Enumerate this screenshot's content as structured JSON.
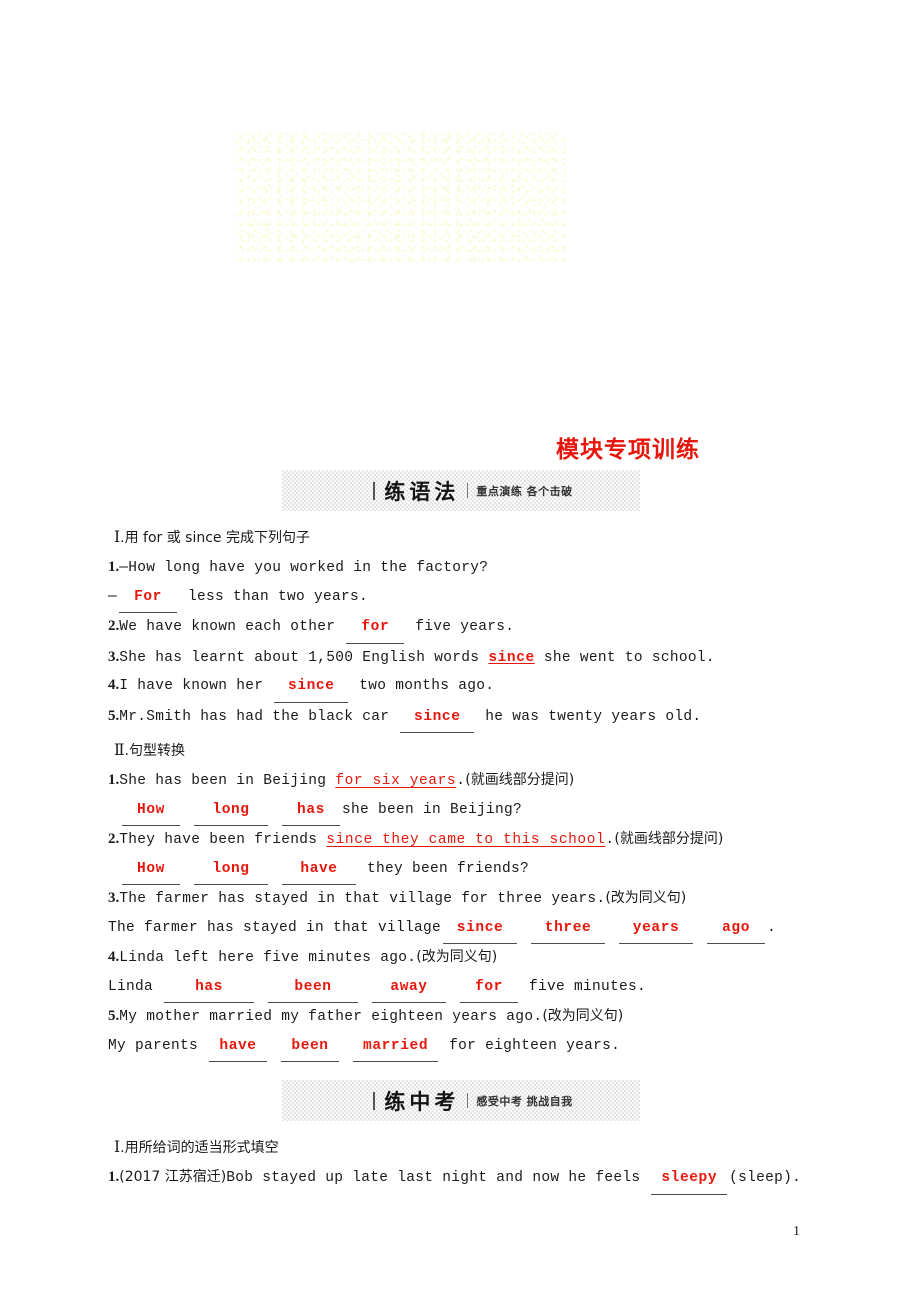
{
  "document": {
    "title": "模块专项训练",
    "page_number": "1",
    "watermark": "faint-dotted-graphic"
  },
  "sections": [
    {
      "banner": {
        "main": "练语法",
        "sub": "重点演练 各个击破"
      },
      "groups": [
        {
          "heading_roman": "Ⅰ",
          "heading_text": ".用 for 或 since 完成下列句子",
          "items": [
            {
              "number": "1.",
              "lines": [
                {
                  "text": "—How long have you worked in the factory?"
                },
                {
                  "prefix": "—",
                  "answer": "For",
                  "suffix": " less than two years."
                }
              ]
            },
            {
              "number": "2.",
              "lines": [
                {
                  "prefix": "We have known each other ",
                  "answer": "for",
                  "suffix": " five years."
                }
              ]
            },
            {
              "number": "3.",
              "lines": [
                {
                  "prefix": "She has learnt about 1,500 English words ",
                  "answer_inline": "since",
                  "suffix": " she went to school."
                }
              ]
            },
            {
              "number": "4.",
              "lines": [
                {
                  "prefix": "I have known her ",
                  "answer": "since",
                  "suffix": " two months ago."
                }
              ]
            },
            {
              "number": "5.",
              "lines": [
                {
                  "prefix": "Mr.Smith has had the black car ",
                  "answer": "since",
                  "suffix": " he was twenty years old."
                }
              ]
            }
          ]
        },
        {
          "heading_roman": "Ⅱ",
          "heading_text": ".句型转换",
          "items": [
            {
              "number": "1.",
              "prompt_prefix": "She has been in Beijing ",
              "prompt_underline": "for six years",
              "prompt_suffix": ".",
              "prompt_note": "(就画线部分提问)",
              "answers": [
                "How",
                "long",
                "has"
              ],
              "answer_tail": "she been in Beijing?"
            },
            {
              "number": "2.",
              "prompt_prefix": "They have been friends ",
              "prompt_underline": "since they came to this school",
              "prompt_suffix": ".",
              "prompt_note": "(就画线部分提问)",
              "answers": [
                "How",
                "long",
                "have"
              ],
              "answer_tail": " they been friends?"
            },
            {
              "number": "3.",
              "prompt_prefix": "The farmer has stayed in that village for three years.",
              "prompt_note": "(改为同义句)",
              "answer_lead": "The farmer has stayed in that village",
              "answers": [
                "since",
                "three",
                "years",
                "ago"
              ],
              "answer_tail": "."
            },
            {
              "number": "4.",
              "prompt_prefix": "Linda left here five minutes ago.",
              "prompt_note": "(改为同义句)",
              "answer_lead": "Linda ",
              "answers": [
                "has",
                "been",
                "away",
                "for"
              ],
              "answer_tail": " five minutes."
            },
            {
              "number": "5.",
              "prompt_prefix": "My mother married my father eighteen years ago.",
              "prompt_note": "(改为同义句)",
              "answer_lead": "My parents ",
              "answers": [
                "have",
                "been",
                "married"
              ],
              "answer_tail": " for eighteen years."
            }
          ]
        }
      ]
    },
    {
      "banner": {
        "main": "练中考",
        "sub": "感受中考 挑战自我"
      },
      "groups": [
        {
          "heading_roman": "Ⅰ",
          "heading_text": ".用所给词的适当形式填空",
          "items": [
            {
              "number": "1.",
              "source": "(2017 江苏宿迁)",
              "prefix": "Bob stayed up late last night and now he feels ",
              "answer": "sleepy",
              "suffix": "(sleep)."
            }
          ]
        }
      ]
    }
  ],
  "colors": {
    "answer_red": "#e8170d",
    "title_red": "#e8170d",
    "banner_gray": "#e6e6e6",
    "text_black": "#1a1a1a"
  }
}
